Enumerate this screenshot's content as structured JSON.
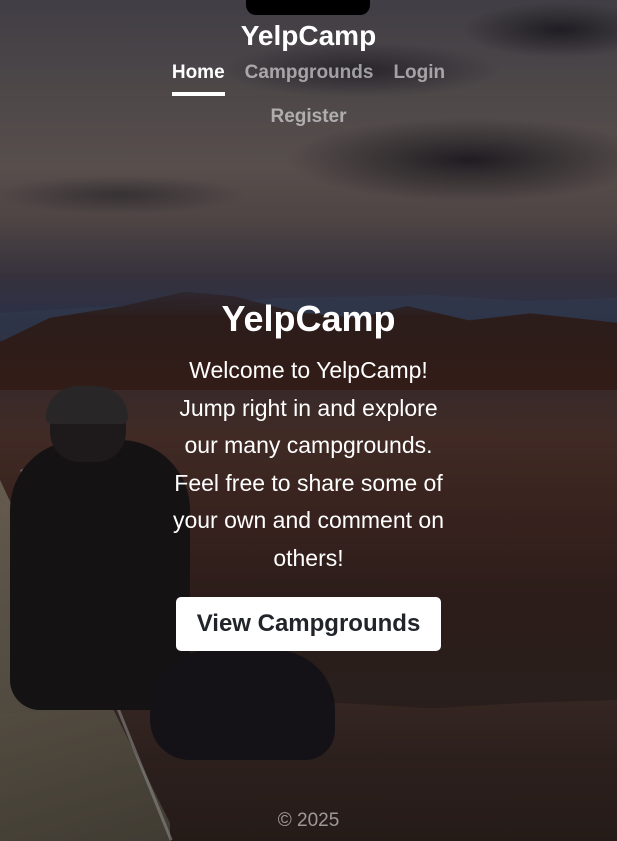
{
  "header": {
    "brand": "YelpCamp",
    "nav": {
      "home": "Home",
      "campgrounds": "Campgrounds",
      "login": "Login",
      "register": "Register"
    }
  },
  "hero": {
    "title": "YelpCamp",
    "lines": [
      "Welcome to YelpCamp!",
      "Jump right in and explore",
      "our many campgrounds.",
      "Feel free to share some of",
      "your own and comment on",
      "others!"
    ],
    "button_label": "View Campgrounds"
  },
  "footer": {
    "copyright": "© 2025"
  },
  "colors": {
    "text": "#ffffff",
    "nav_inactive": "rgba(255,255,255,0.55)",
    "button_bg": "#ffffff",
    "button_text": "#212529"
  }
}
